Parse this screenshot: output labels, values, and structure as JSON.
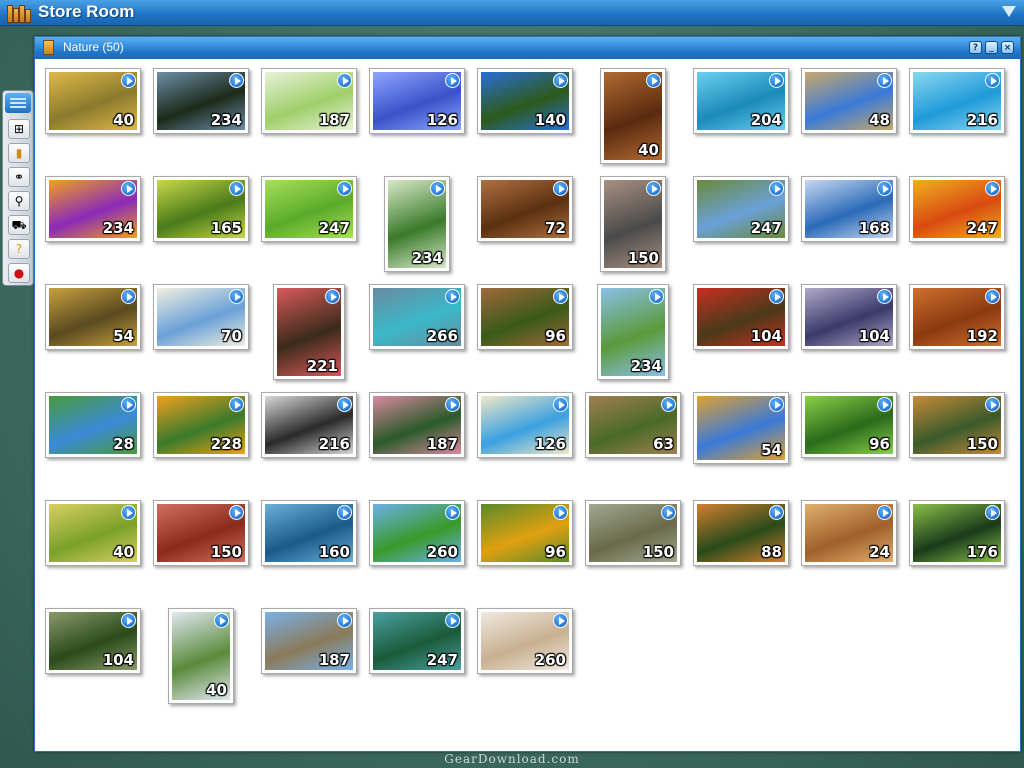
{
  "app": {
    "title": "Store Room"
  },
  "window": {
    "title": "Nature (50)",
    "buttons": [
      "?",
      "_",
      "×"
    ]
  },
  "toolbar": {
    "tools": [
      {
        "name": "puzzle-tool",
        "icon": "puzzle-icon",
        "glyph": "⊞"
      },
      {
        "name": "book-tool",
        "icon": "book-icon",
        "glyph": "▮"
      },
      {
        "name": "binoculars-tool",
        "icon": "binoculars-icon",
        "glyph": "⚭"
      },
      {
        "name": "search-tool",
        "icon": "magnifier-icon",
        "glyph": "⚲"
      },
      {
        "name": "cart-tool",
        "icon": "cart-icon",
        "glyph": "⛟"
      },
      {
        "name": "help-tool",
        "icon": "help-icon",
        "glyph": "?"
      },
      {
        "name": "record-tool",
        "icon": "record-icon",
        "glyph": "●"
      }
    ]
  },
  "colors": {
    "titlebar": "#1f73c4",
    "desktop": "#3f6d62",
    "play": "#0b5cc0"
  },
  "puzzles": [
    {
      "count": "40",
      "colors": [
        "#8a7a2c",
        "#e0b84a"
      ]
    },
    {
      "count": "234",
      "colors": [
        "#1c2a1a",
        "#6d8fa8"
      ]
    },
    {
      "count": "187",
      "colors": [
        "#9fcf6a",
        "#e8f2d8"
      ]
    },
    {
      "count": "126",
      "colors": [
        "#3a52c8",
        "#8ea6ff"
      ]
    },
    {
      "count": "140",
      "colors": [
        "#2c5a1a",
        "#2a6fd8"
      ]
    },
    {
      "count": "40",
      "colors": [
        "#5a2a10",
        "#b06a30"
      ]
    },
    {
      "count": "204",
      "colors": [
        "#1a8ab8",
        "#6ad0f0"
      ]
    },
    {
      "count": "48",
      "colors": [
        "#3a7ad8",
        "#c8a86a"
      ]
    },
    {
      "count": "216",
      "colors": [
        "#1f9ad8",
        "#8ad8f0"
      ]
    },
    {
      "count": "234",
      "colors": [
        "#8a2ab8",
        "#f0a020"
      ]
    },
    {
      "count": "165",
      "colors": [
        "#4a7a1a",
        "#c8d84a"
      ]
    },
    {
      "count": "247",
      "colors": [
        "#5aaa2a",
        "#a8e05a"
      ]
    },
    {
      "count": "234",
      "colors": [
        "#3a7a2a",
        "#d8e8c8"
      ]
    },
    {
      "count": "72",
      "colors": [
        "#5a3010",
        "#b07040"
      ]
    },
    {
      "count": "150",
      "colors": [
        "#4a4a4a",
        "#a89080"
      ]
    },
    {
      "count": "247",
      "colors": [
        "#6aa0d8",
        "#6a8a3a"
      ]
    },
    {
      "count": "168",
      "colors": [
        "#2a6ab8",
        "#c8d8f0"
      ]
    },
    {
      "count": "247",
      "colors": [
        "#d84a10",
        "#f0b020"
      ]
    },
    {
      "count": "54",
      "colors": [
        "#5a4a20",
        "#c8a040"
      ]
    },
    {
      "count": "70",
      "colors": [
        "#6aa0d8",
        "#f0f0e0"
      ]
    },
    {
      "count": "221",
      "colors": [
        "#3a2a1a",
        "#d85a5a"
      ]
    },
    {
      "count": "266",
      "colors": [
        "#3ab8c8",
        "#6a8aa0"
      ]
    },
    {
      "count": "96",
      "colors": [
        "#3a5a1a",
        "#a06a3a"
      ]
    },
    {
      "count": "234",
      "colors": [
        "#5a9a3a",
        "#8ac0e8"
      ]
    },
    {
      "count": "104",
      "colors": [
        "#4a3a1a",
        "#c83020"
      ]
    },
    {
      "count": "104",
      "colors": [
        "#3a3a6a",
        "#b0a8c8"
      ]
    },
    {
      "count": "192",
      "colors": [
        "#8a3a10",
        "#d07030"
      ]
    },
    {
      "count": "28",
      "colors": [
        "#3a8ad8",
        "#4a9a3a"
      ]
    },
    {
      "count": "228",
      "colors": [
        "#3a7a2a",
        "#f0a020"
      ]
    },
    {
      "count": "216",
      "colors": [
        "#2a2a2a",
        "#d8d8d8"
      ]
    },
    {
      "count": "187",
      "colors": [
        "#2a5a2a",
        "#d88aa0"
      ]
    },
    {
      "count": "126",
      "colors": [
        "#3aa0e0",
        "#f0e8c8"
      ]
    },
    {
      "count": "63",
      "colors": [
        "#4a6a2a",
        "#a08050"
      ]
    },
    {
      "count": "54",
      "colors": [
        "#3a7ad8",
        "#e0a030"
      ]
    },
    {
      "count": "96",
      "colors": [
        "#2a6a1a",
        "#8ad04a"
      ]
    },
    {
      "count": "150",
      "colors": [
        "#3a5a2a",
        "#c88a3a"
      ]
    },
    {
      "count": "40",
      "colors": [
        "#7aa02a",
        "#d8d060"
      ]
    },
    {
      "count": "150",
      "colors": [
        "#8a2a1a",
        "#d07060"
      ]
    },
    {
      "count": "160",
      "colors": [
        "#1a5a8a",
        "#6ab0d8"
      ]
    },
    {
      "count": "260",
      "colors": [
        "#3a9a2a",
        "#6ab0e8"
      ]
    },
    {
      "count": "96",
      "colors": [
        "#e0a010",
        "#5a8a2a"
      ]
    },
    {
      "count": "150",
      "colors": [
        "#6a6a4a",
        "#a0a890"
      ]
    },
    {
      "count": "88",
      "colors": [
        "#2a4a1a",
        "#d08030"
      ]
    },
    {
      "count": "24",
      "colors": [
        "#a0602a",
        "#e0b070"
      ]
    },
    {
      "count": "176",
      "colors": [
        "#1a3a1a",
        "#8ac04a"
      ]
    },
    {
      "count": "104",
      "colors": [
        "#2a4a1a",
        "#8a9a6a"
      ]
    },
    {
      "count": "40",
      "colors": [
        "#5a8a3a",
        "#e0e8f0"
      ]
    },
    {
      "count": "187",
      "colors": [
        "#8a7a5a",
        "#7ab0e8"
      ]
    },
    {
      "count": "247",
      "colors": [
        "#1a5a3a",
        "#4aa0a0"
      ]
    },
    {
      "count": "260",
      "colors": [
        "#c8b090",
        "#f0e8e0"
      ]
    }
  ],
  "watermark": "GearDownload.com"
}
